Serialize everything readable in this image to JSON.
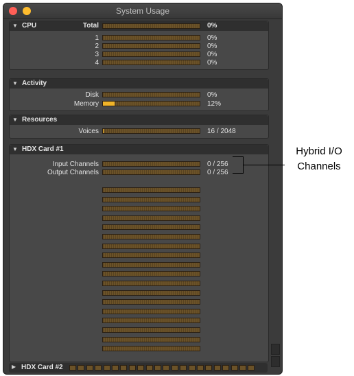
{
  "window": {
    "title": "System Usage"
  },
  "sections": {
    "cpu": {
      "title": "CPU",
      "rows": [
        {
          "label": "Total",
          "value": "0%",
          "level": 0
        },
        {
          "label": "1",
          "value": "0%",
          "level": 0
        },
        {
          "label": "2",
          "value": "0%",
          "level": 0
        },
        {
          "label": "3",
          "value": "0%",
          "level": 0
        },
        {
          "label": "4",
          "value": "0%",
          "level": 0
        }
      ]
    },
    "activity": {
      "title": "Activity",
      "rows": [
        {
          "label": "Disk",
          "value": "0%",
          "level": 0
        },
        {
          "label": "Memory",
          "value": "12%",
          "level": 0.12
        }
      ]
    },
    "resources": {
      "title": "Resources",
      "rows": [
        {
          "label": "Voices",
          "value": "16 / 2048",
          "level": 0.0078
        }
      ]
    },
    "hdx1": {
      "title": "HDX Card #1",
      "rows": [
        {
          "label": "Input Channels",
          "value": "0 / 256",
          "level": 0
        },
        {
          "label": "Output Channels",
          "value": "0 / 256",
          "level": 0
        }
      ],
      "dsp_meter_count": 18
    },
    "hdx2": {
      "title": "HDX Card #2",
      "mini_meter_count": 22
    }
  },
  "callout": {
    "line1": "Hybrid I/O",
    "line2": "Channels"
  },
  "colors": {
    "meter": "#6b5228",
    "meter_fill": "#f0b429"
  },
  "icons": {
    "collapse": "triangle-down-icon",
    "expand": "triangle-right-icon"
  }
}
